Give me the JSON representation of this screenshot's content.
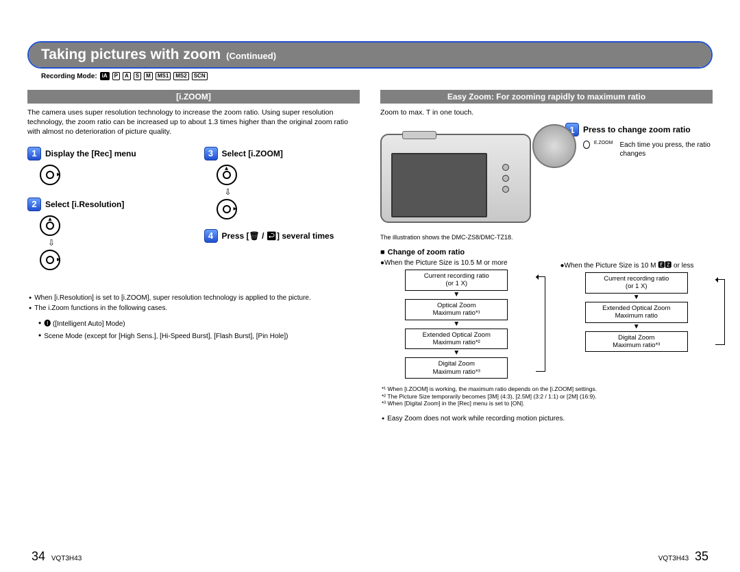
{
  "header": {
    "title": "Taking pictures with zoom",
    "continued": "(Continued)",
    "rec_mode_label": "Recording Mode:",
    "modes": [
      "iA",
      "P",
      "A",
      "S",
      "M",
      "MS1",
      "MS2",
      "SCN"
    ]
  },
  "left": {
    "section_title": "[i.ZOOM]",
    "intro": "The camera uses super resolution technology to increase the zoom ratio. Using super resolution technology, the zoom ratio can be increased up to about 1.3 times higher than the original zoom ratio with almost no deterioration of picture quality.",
    "step1": "Display the [Rec] menu",
    "step2": "Select [i.Resolution]",
    "step3": "Select [i.ZOOM]",
    "step4": "Press [🗑 / ↩] several times",
    "note1": "When [i.Resolution] is set to [i.ZOOM], super resolution technology is applied to the picture.",
    "note2": "The i.Zoom functions in the following cases.",
    "note2a": "🅘 ([Intelligent Auto] Mode)",
    "note2b": "Scene Mode (except for [High Sens.], [Hi-Speed Burst], [Flash Burst], [Pin Hole])"
  },
  "right": {
    "section_title": "Easy Zoom: For zooming rapidly to maximum ratio",
    "intro": "Zoom to max. T in one touch.",
    "step1": "Press to change zoom ratio",
    "step1_desc": "Each time you press, the ratio changes",
    "ezoom_label": "E.ZOOM",
    "illus_note": "The illustration shows the DMC-ZS8/DMC-TZ18.",
    "change_head": "Change of zoom ratio",
    "condA": "When the Picture Size is 10.5 M or more",
    "condB": "When the Picture Size is 10 M 🅴🆉 or less",
    "flowA": [
      "Current recording ratio\n(or 1 X)",
      "Optical Zoom\nMaximum ratio*¹",
      "Extended Optical Zoom\nMaximum ratio*²",
      "Digital Zoom\nMaximum ratio*³"
    ],
    "flowB": [
      "Current recording ratio\n(or 1 X)",
      "Extended Optical Zoom\nMaximum ratio",
      "Digital Zoom\nMaximum ratio*³"
    ],
    "fn1": "*¹ When [i.ZOOM] is working, the maximum ratio depends on the [i.ZOOM] settings.",
    "fn2": "*² The Picture Size temporarily becomes [3M] (4:3), [2.5M] (3:2 / 1:1) or [2M] (16:9).",
    "fn3": "*³ When [Digital Zoom] in the [Rec] menu is set to [ON].",
    "final": "Easy Zoom does not work while recording motion pictures."
  },
  "footer": {
    "doc_id": "VQT3H43",
    "page_left": "34",
    "page_right": "35"
  }
}
